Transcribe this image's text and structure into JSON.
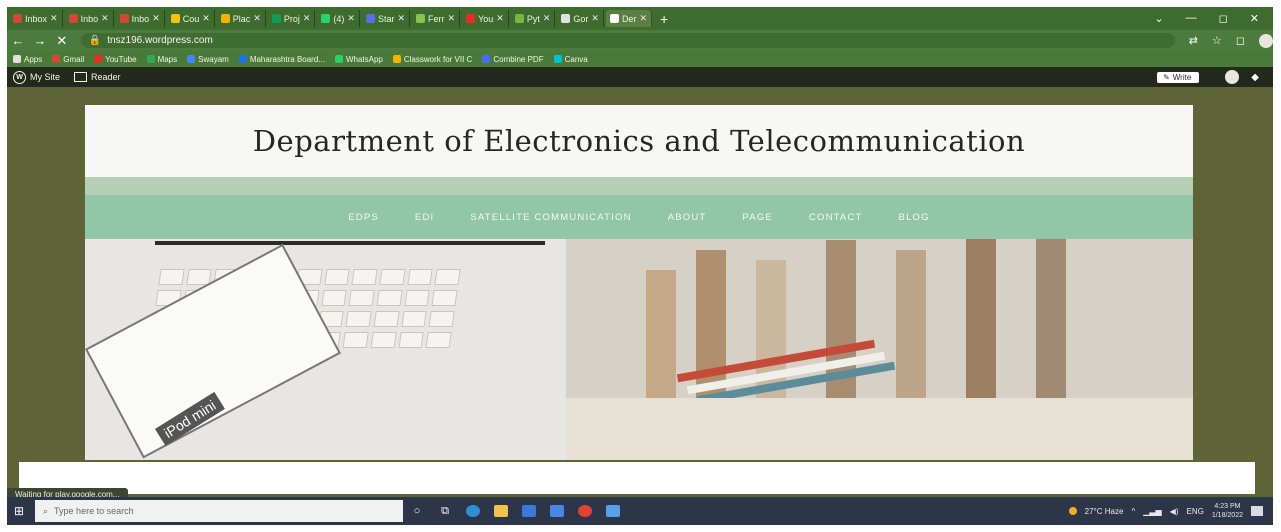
{
  "tabs": [
    {
      "label": "Inbox",
      "color": "#d44638"
    },
    {
      "label": "Inbo",
      "color": "#d44638"
    },
    {
      "label": "Inbo",
      "color": "#d44638"
    },
    {
      "label": "Cou",
      "color": "#f4c20d"
    },
    {
      "label": "Plac",
      "color": "#f4b400"
    },
    {
      "label": "Proj",
      "color": "#0f9d58"
    },
    {
      "label": "(4)",
      "color": "#25d366"
    },
    {
      "label": "Star",
      "color": "#5b6ee1"
    },
    {
      "label": "Ferr",
      "color": "#8bc34a"
    },
    {
      "label": "You",
      "color": "#e52d27"
    },
    {
      "label": "Pyt",
      "color": "#7cb342"
    },
    {
      "label": "Gor",
      "color": "#e0e0e0"
    },
    {
      "label": "Der",
      "color": "#ffffff",
      "active": true
    }
  ],
  "window_controls": {
    "menu": "⌄",
    "minimize": "—",
    "restore": "◻",
    "close": "✕"
  },
  "toolbar": {
    "back": "←",
    "forward": "→",
    "reload": "✕",
    "url": "tnsz196.wordpress.com",
    "lock": "🔒"
  },
  "bookmarks": [
    {
      "label": "Apps",
      "color": "#e0e0e0"
    },
    {
      "label": "Gmail",
      "color": "#d44638"
    },
    {
      "label": "YouTube",
      "color": "#e52d27"
    },
    {
      "label": "Maps",
      "color": "#34a853"
    },
    {
      "label": "Swayam",
      "color": "#4285f4"
    },
    {
      "label": "Maharashtra Board...",
      "color": "#1a73e8"
    },
    {
      "label": "WhatsApp",
      "color": "#25d366"
    },
    {
      "label": "Classwork for VII C",
      "color": "#f4b400"
    },
    {
      "label": "Combine PDF",
      "color": "#4a6cf7"
    },
    {
      "label": "Canva",
      "color": "#00c4cc"
    }
  ],
  "adminbar": {
    "my_site": "My Site",
    "reader": "Reader",
    "write": "Write"
  },
  "site": {
    "title": "Department of Electronics and Telecommunication",
    "nav": [
      "EDPS",
      "EDI",
      "SATELLITE COMMUNICATION",
      "ABOUT",
      "PAGE",
      "CONTACT",
      "BLOG"
    ],
    "hero_label": "iPod mini"
  },
  "status_text": "Waiting for play.google.com...",
  "taskbar": {
    "search_placeholder": "Type here to search",
    "weather": "27°C Haze",
    "lang": "ENG",
    "time": "4:23 PM",
    "date": "1/18/2022"
  }
}
